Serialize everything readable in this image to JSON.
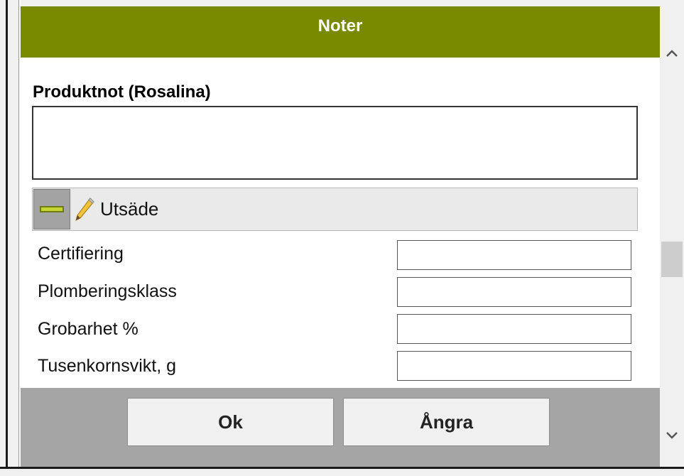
{
  "dialog": {
    "title": "Noter",
    "product_note_label": "Produktnot (Rosalina)",
    "product_note_value": ""
  },
  "section": {
    "title": "Utsäde",
    "expanded": true,
    "fields": [
      {
        "label": "Certifiering",
        "value": ""
      },
      {
        "label": "Plomberingsklass",
        "value": ""
      },
      {
        "label": "Grobarhet %",
        "value": ""
      },
      {
        "label": "Tusenkornsvikt, g",
        "value": ""
      }
    ]
  },
  "buttons": {
    "ok": "Ok",
    "cancel": "Ångra"
  },
  "icons": {
    "collapse": "minus-icon",
    "edit": "pencil-icon",
    "scroll_up": "chevron-up-icon",
    "scroll_down": "chevron-down-icon"
  },
  "colors": {
    "header_bg": "#7a8a00",
    "footer_bg": "#a5a5a5",
    "collapse_accent": "#c6d631"
  }
}
